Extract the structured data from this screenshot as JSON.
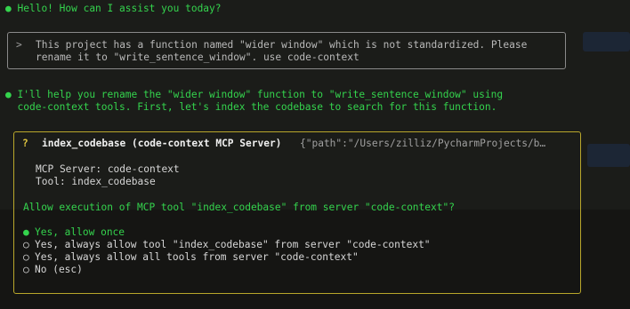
{
  "assistant_greeting": {
    "bullet": "●",
    "text": "Hello! How can I assist you today?"
  },
  "user_message": {
    "caret": ">",
    "lines": [
      "This project has a function named \"wider window\" which is not standardized. Please",
      "rename it to \"write_sentence_window\". use code-context"
    ]
  },
  "assistant_reply": {
    "bullet": "●",
    "lines": [
      "I'll help you rename the \"wider window\" function to \"write_sentence_window\" using",
      "code-context tools. First, let's index the codebase to search for this function."
    ]
  },
  "permission_dialog": {
    "question_mark": "?",
    "tool_title": "index_codebase (code-context MCP Server)",
    "tool_args": "{\"path\":\"/Users/zilliz/PycharmProjects/b…",
    "server_line": "MCP Server: code-context",
    "tool_line": "Tool: index_codebase",
    "prompt": "Allow execution of MCP tool \"index_codebase\" from server \"code-context\"?",
    "options": [
      {
        "mark": "●",
        "label": "Yes, allow once",
        "selected": true
      },
      {
        "mark": "○",
        "label": "Yes, always allow tool \"index_codebase\" from server \"code-context\"",
        "selected": false
      },
      {
        "mark": "○",
        "label": "Yes, always allow all tools from server \"code-context\"",
        "selected": false
      },
      {
        "mark": "○",
        "label": "No (esc)",
        "selected": false
      }
    ]
  },
  "colors": {
    "background": "#1b1c19",
    "assistant_green": "#34d34d",
    "dialog_border": "#b9a72b",
    "user_border": "#8a8a8a"
  }
}
